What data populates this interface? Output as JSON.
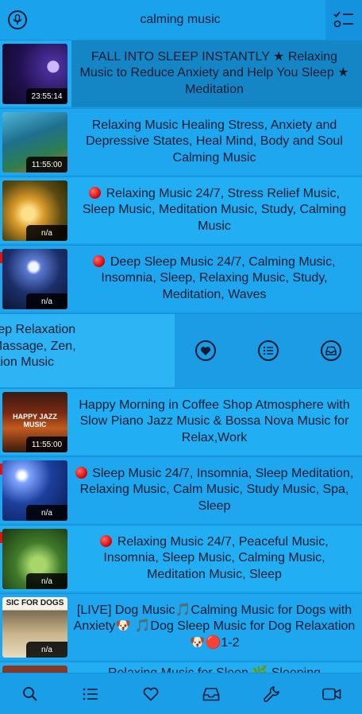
{
  "search": {
    "value": "calming music",
    "placeholder": ""
  },
  "videos": [
    {
      "title": "FALL INTO SLEEP INSTANTLY ★ Relaxing Music to Reduce Anxiety and Help You Sleep ★ Meditation",
      "duration": "23:55:14",
      "selected": true
    },
    {
      "title": "Relaxing Music Healing Stress, Anxiety and Depressive States, Heal Mind, Body and Soul Calming Music",
      "duration": "11:55:00"
    },
    {
      "title": "Relaxing Music 24/7, Stress Relief Music, Sleep Music, Meditation Music, Study, Calming Music",
      "duration": "n/a",
      "live": true
    },
    {
      "title": "Deep Sleep Music 24/7, Calming Music, Insomnia, Sleep, Relaxing Music, Study, Meditation, Waves",
      "duration": "n/a",
      "live": true
    },
    {
      "title": "Happy Morning in Coffee Shop Atmosphere with Slow Piano Jazz Music & Bossa Nova Music for Relax,Work",
      "duration": "11:55:00",
      "thumb_text": "HAPPY JAZZ MUSIC"
    },
    {
      "title": "Sleep Music 24/7, Insomnia, Sleep Meditation, Relaxing Music, Calm Music, Study Music, Spa, Sleep",
      "duration": "n/a",
      "live": true
    },
    {
      "title": "Relaxing Music 24/7, Peaceful Music, Insomnia, Sleep Music, Calming Music, Meditation Music, Sleep",
      "duration": "n/a",
      "live": true
    },
    {
      "title": "[LIVE] Dog Music🎵Calming Music for Dogs with Anxiety🐶 🎵Dog Sleep Music for Dog Relaxation🐶🔴1-2",
      "duration": "n/a",
      "thumb_text": "SIC FOR DOGS"
    },
    {
      "title": "Relaxing Music for Sleep 🌿 Sleeping",
      "duration": ""
    }
  ],
  "swipe_row": {
    "lines": [
      "usic for Deep Relaxation",
      "Music for Massage, Zen,",
      "Meditation Music"
    ],
    "actions": [
      "heart-icon",
      "list-icon",
      "inbox-icon"
    ]
  },
  "tabs": [
    "search-icon",
    "list-icon",
    "heart-icon",
    "inbox-icon",
    "wrench-icon",
    "video-icon"
  ],
  "colors": {
    "bar": "#1a9ee8",
    "row": "#22aef2",
    "selected": "#1486c6",
    "text": "#0b1c33"
  }
}
